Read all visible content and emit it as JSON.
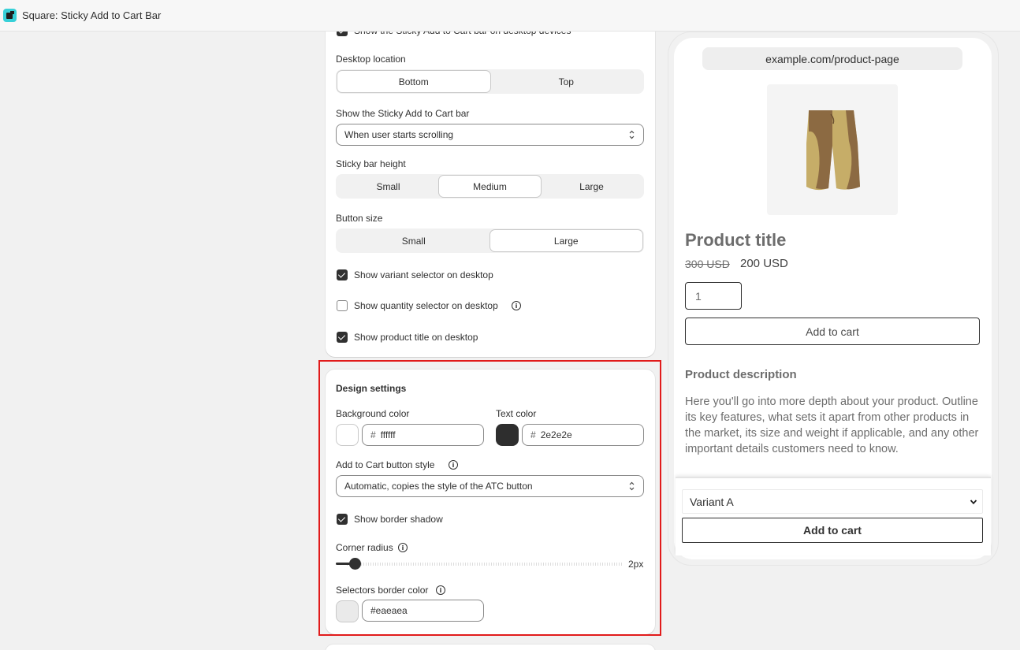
{
  "window": {
    "title": "Square: Sticky Add to Cart Bar"
  },
  "settings": {
    "desktop_checkbox_label": "Show the Sticky Add to Cart bar on desktop devices",
    "desktop_location": {
      "label": "Desktop location",
      "options": [
        "Bottom",
        "Top"
      ],
      "selected": "Bottom"
    },
    "show_bar": {
      "label": "Show the Sticky Add to Cart bar",
      "value": "When user starts scrolling"
    },
    "bar_height": {
      "label": "Sticky bar height",
      "options": [
        "Small",
        "Medium",
        "Large"
      ],
      "selected": "Medium"
    },
    "button_size": {
      "label": "Button size",
      "options": [
        "Small",
        "Large"
      ],
      "selected": "Large"
    },
    "checkboxes": [
      {
        "label": "Show variant selector on desktop",
        "checked": true
      },
      {
        "label": "Show quantity selector on desktop",
        "checked": false,
        "info": true
      },
      {
        "label": "Show product title on desktop",
        "checked": true
      }
    ]
  },
  "design": {
    "title": "Design settings",
    "background_color": {
      "label": "Background color",
      "hash": "#",
      "value": "ffffff",
      "swatch": "#ffffff"
    },
    "text_color": {
      "label": "Text color",
      "hash": "#",
      "value": "2e2e2e",
      "swatch": "#2e2e2e"
    },
    "atc_style": {
      "label": "Add to Cart button style",
      "value": "Automatic, copies the style of the ATC button"
    },
    "border_shadow": {
      "label": "Show border shadow",
      "checked": true
    },
    "corner_radius": {
      "label": "Corner radius",
      "value": "2px",
      "level": 0.04
    },
    "selectors_border": {
      "label": "Selectors border color",
      "value": "#eaeaea",
      "swatch": "#eaeaea"
    }
  },
  "preview": {
    "url": "example.com/product-page",
    "product_title": "Product title",
    "old_price": "300 USD",
    "new_price": "200 USD",
    "quantity": "1",
    "add_to_cart": "Add to cart",
    "description_heading": "Product description",
    "description": "Here you'll go into more depth about your product. Outline its key features, what sets it apart from other products in the market, its size and weight if applicable, and any other important details customers need to know.",
    "sticky_variant": "Variant A",
    "sticky_add_to_cart": "Add to cart"
  },
  "colors": {
    "accent": "#303030",
    "highlight": "#e11b1b"
  }
}
